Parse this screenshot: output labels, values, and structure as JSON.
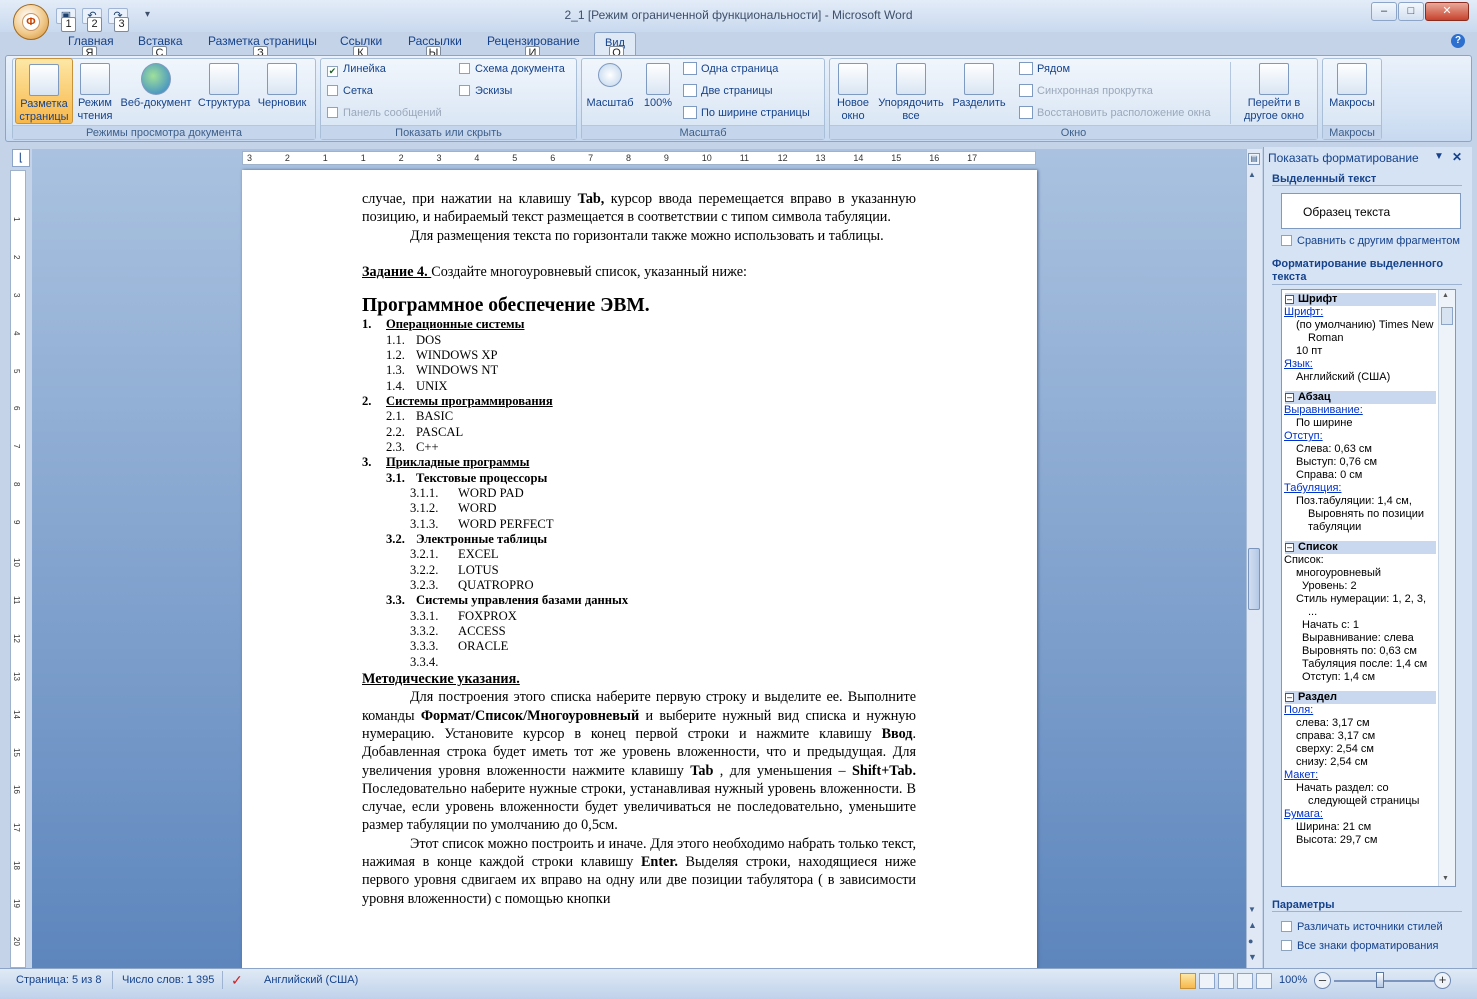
{
  "window": {
    "title": "2_1 [Режим ограниченной функциональности] - Microsoft Word",
    "office_button_letter": "Ф",
    "qat_keytips": [
      "1",
      "2",
      "3"
    ],
    "min_label": "–",
    "max_label": "□",
    "close_label": "✕",
    "help_label": "?"
  },
  "tabs": [
    {
      "label": "Главная",
      "keytip": "Я"
    },
    {
      "label": "Вставка",
      "keytip": "С"
    },
    {
      "label": "Разметка страницы",
      "keytip": "З"
    },
    {
      "label": "Ссылки",
      "keytip": "К"
    },
    {
      "label": "Рассылки",
      "keytip": "Ы"
    },
    {
      "label": "Рецензирование",
      "keytip": "И"
    },
    {
      "label": "Вид",
      "keytip": "О",
      "active": true
    }
  ],
  "ribbon": {
    "views_group": {
      "caption": "Режимы просмотра документа",
      "buttons": [
        {
          "label": "Разметка страницы",
          "active": true
        },
        {
          "label": "Режим чтения"
        },
        {
          "label": "Веб-документ"
        },
        {
          "label": "Структура"
        },
        {
          "label": "Черновик"
        }
      ]
    },
    "show_group": {
      "caption": "Показать или скрыть",
      "items": [
        {
          "label": "Линейка",
          "checked": true
        },
        {
          "label": "Сетка",
          "checked": false
        },
        {
          "label": "Панель сообщений",
          "checked": false,
          "disabled": true
        },
        {
          "label": "Схема документа",
          "checked": false
        },
        {
          "label": "Эскизы",
          "checked": false
        }
      ]
    },
    "zoom_group": {
      "caption": "Масштаб",
      "zoom_label": "Масштаб",
      "hundred_label": "100%",
      "one_page": "Одна страница",
      "two_pages": "Две страницы",
      "page_width": "По ширине страницы"
    },
    "window_group": {
      "caption": "Окно",
      "new_window": "Новое окно",
      "arrange_all": "Упорядочить все",
      "split": "Разделить",
      "side_by_side": "Рядом",
      "sync_scroll": "Синхронная прокрутка",
      "reset_position": "Восстановить расположение окна",
      "switch_windows": "Перейти в другое окно"
    },
    "macros_group": {
      "caption": "Макросы",
      "label": "Макросы"
    }
  },
  "ruler": {
    "ticks": [
      "3",
      "2",
      "1",
      "1",
      "2",
      "3",
      "4",
      "5",
      "6",
      "7",
      "8",
      "9",
      "10",
      "11",
      "12",
      "13",
      "14",
      "15",
      "16",
      "17"
    ]
  },
  "document": {
    "para1": "случае, при нажатии на клавишу ",
    "para1_bold": "Tab,",
    "para1_rest": " курсор ввода перемещается вправо в указанную позицию, и набираемый текст размещается в соответствии с типом символа табуляции.",
    "para2": "Для размещения текста по горизонтали также можно использовать и таблицы.",
    "task_label": "Задание 4. ",
    "task_text": "Создайте многоуровневый список, указанный ниже:",
    "heading": "Программное обеспечение ЭВМ.",
    "list": [
      {
        "lvl": 1,
        "n": "1.",
        "t": "Операционные системы"
      },
      {
        "lvl": 2,
        "n": "1.1.",
        "t": "DOS"
      },
      {
        "lvl": 2,
        "n": "1.2.",
        "t": "WINDOWS XP"
      },
      {
        "lvl": 2,
        "n": "1.3.",
        "t": "WINDOWS NT"
      },
      {
        "lvl": 2,
        "n": "1.4.",
        "t": "UNIX"
      },
      {
        "lvl": 1,
        "n": "2.",
        "t": "Системы программирования"
      },
      {
        "lvl": 2,
        "n": "2.1.",
        "t": "BASIC"
      },
      {
        "lvl": 2,
        "n": "2.2.",
        "t": "PASCAL"
      },
      {
        "lvl": 2,
        "n": "2.3.",
        "t": "C++"
      },
      {
        "lvl": 1,
        "n": "3.",
        "t": "Прикладные программы"
      },
      {
        "lvl": 2,
        "n": "3.1.",
        "t": "Текстовые процессоры",
        "bold": true
      },
      {
        "lvl": 3,
        "n": "3.1.1.",
        "t": "WORD PAD"
      },
      {
        "lvl": 3,
        "n": "3.1.2.",
        "t": "WORD"
      },
      {
        "lvl": 3,
        "n": "3.1.3.",
        "t": "WORD PERFECT"
      },
      {
        "lvl": 2,
        "n": "3.2.",
        "t": "Электронные таблицы",
        "bold": true
      },
      {
        "lvl": 3,
        "n": "3.2.1.",
        "t": "EXCEL"
      },
      {
        "lvl": 3,
        "n": "3.2.2.",
        "t": "LOTUS"
      },
      {
        "lvl": 3,
        "n": "3.2.3.",
        "t": "QUATROPRO"
      },
      {
        "lvl": 2,
        "n": "3.3.",
        "t": "Системы управления базами данных",
        "bold": true
      },
      {
        "lvl": 3,
        "n": "3.3.1.",
        "t": "FOXPROX"
      },
      {
        "lvl": 3,
        "n": "3.3.2.",
        "t": "ACCESS"
      },
      {
        "lvl": 3,
        "n": "3.3.3.",
        "t": "ORACLE"
      },
      {
        "lvl": 3,
        "n": "3.3.4.",
        "t": ""
      }
    ],
    "method_heading": "Методические указания.",
    "m1a": "Для построения этого списка наберите первую строку и выделите ее. Выполните команды ",
    "m1b": "Формат/Список/Многоуровневый",
    "m1c": "  и выберите нужный вид списка и нужную нумерацию. Установите курсор в конец первой строки и нажмите клавишу ",
    "m1d": "Ввод",
    "m1e": ". Добавленная строка будет иметь тот же уровень вложенности, что и предыдущая. Для увеличения уровня вложенности нажмите клавишу ",
    "m1f": "Tab",
    "m1g": " , для уменьшения – ",
    "m1h": "Shift+Tab.",
    "m1i": " Последовательно наберите нужные строки, устанавливая нужный уровень вложенности. В случае, если уровень вложенности будет увеличиваться не последовательно, уменьшите размер табуляции по умолчанию до 0,5см.",
    "m2a": "Этот список можно построить и иначе. Для этого необходимо набрать только текст, нажимая в конце каждой строки клавишу ",
    "m2b": "Enter.",
    "m2c": " Выделяя строки, находящиеся ниже первого уровня сдвигаем их вправо на одну или две позиции табулятора ( в зависимости уровня вложенности) с помощью кнопки"
  },
  "taskpane": {
    "title": "Показать форматирование",
    "selected_text": "Выделенный текст",
    "sample": "Образец текста",
    "compare": "Сравнить с другим фрагментом",
    "format_heading": "Форматирование выделенного текста",
    "font_section": "Шрифт",
    "font_link": "Шрифт:",
    "font_value": "(по умолчанию) Times New",
    "font_value2": "Roman",
    "font_size": "10 пт",
    "lang_link": "Язык:",
    "lang_value": "Английский (США)",
    "para_section": "Абзац",
    "align_link": "Выравнивание:",
    "align_value": "По ширине",
    "indent_link": "Отступ:",
    "indent_left": "Слева:  0,63 см",
    "indent_hang": "Выступ:  0,76 см",
    "indent_right": "Справа:  0 см",
    "tab_link": "Табуляция:",
    "tab_value": "Поз.табуляции:  1,4 см,",
    "tab_value2": "Выровнять по позиции",
    "tab_value3": "табуляции",
    "list_section": "Список",
    "list_label": "Список:",
    "list_v1": "многоуровневый",
    "list_v2": "Уровень: 2",
    "list_v3": "Стиль нумерации:   1, 2, 3,",
    "list_v4": "...",
    "list_v5": "Начать с: 1",
    "list_v6": "Выравнивание: слева",
    "list_v7": "Выровнять по:  0,63 см",
    "list_v8": "Табуляция после:  1,4 см",
    "list_v9": "Отступ:  1,4 см",
    "sect_section": "Раздел",
    "fields_link": "Поля:",
    "f1": "слева:  3,17 см",
    "f2": "справа:  3,17 см",
    "f3": "сверху:  2,54 см",
    "f4": "снизу:  2,54 см",
    "layout_link": "Макет:",
    "layout_v1": "Начать раздел: со",
    "layout_v2": "следующей страницы",
    "paper_link": "Бумага:",
    "paper_w": "Ширина:  21 см",
    "paper_h": "Высота:  29,7 см",
    "params": "Параметры",
    "opt1": "Различать источники стилей",
    "opt2": "Все знаки форматирования"
  },
  "statusbar": {
    "page": "Страница: 5 из 8",
    "words": "Число слов: 1 395",
    "lang": "Английский (США)",
    "zoom": "100%",
    "zoom_minus": "–",
    "zoom_plus": "+"
  }
}
